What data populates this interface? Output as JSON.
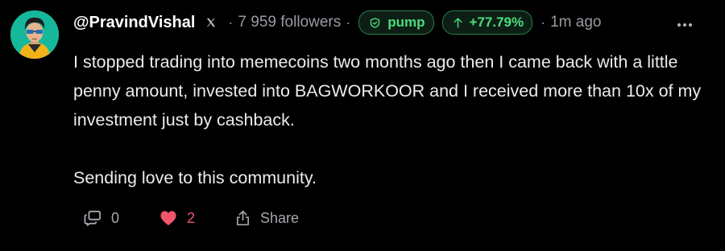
{
  "post": {
    "author": {
      "username": "@PravindVishal",
      "platform_icon": "x-logo-icon",
      "followers": "7 959 followers"
    },
    "tags": {
      "token_label": "pump",
      "token_icon": "shield-check-icon",
      "change_label": "+77.79%",
      "change_icon": "arrow-up-icon"
    },
    "time_ago": "1m ago",
    "separator": "·",
    "more_icon": "more-horizontal-icon",
    "body": [
      "I stopped trading into memecoins two months ago then I came back with a little penny amount, invested into BAGWORKOOR and I received more than 10x of my investment just by cashback.",
      "Sending love to this community."
    ],
    "actions": {
      "reply_count": "0",
      "reply_icon": "reply-icon",
      "like_count": "2",
      "like_icon": "heart-icon",
      "share_label": "Share",
      "share_icon": "share-icon"
    }
  },
  "colors": {
    "background": "#000000",
    "text": "#ececf0",
    "muted": "#9a9aa2",
    "accent_green": "#4ade80",
    "like_red": "#f0556a"
  }
}
